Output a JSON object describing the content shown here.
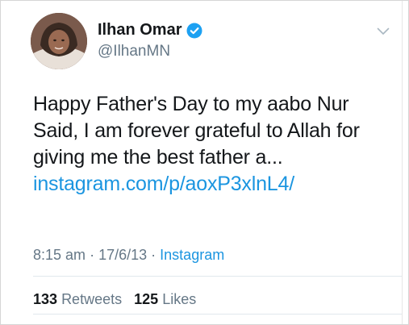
{
  "user": {
    "name": "Ilhan Omar",
    "handle": "@IlhanMN",
    "avatar_icon": "profile-photo",
    "verified_icon": "verified-badge-icon"
  },
  "tweet": {
    "lines": [
      "Happy Father's Day to my aabo Nur",
      "Said, I am forever grateful to Allah for",
      "giving me the best father a..."
    ],
    "link": "instagram.com/p/aoxP3xlnL4/"
  },
  "meta": {
    "time": "8:15 am",
    "date": "17/6/13",
    "separator": "·",
    "source": "Instagram"
  },
  "stats": {
    "retweets_count": "133",
    "retweets_label": "Retweets",
    "likes_count": "125",
    "likes_label": "Likes"
  },
  "colors": {
    "link": "#1b95e0",
    "secondary": "#657786",
    "text": "#14171a",
    "verified": "#1da1f2"
  }
}
